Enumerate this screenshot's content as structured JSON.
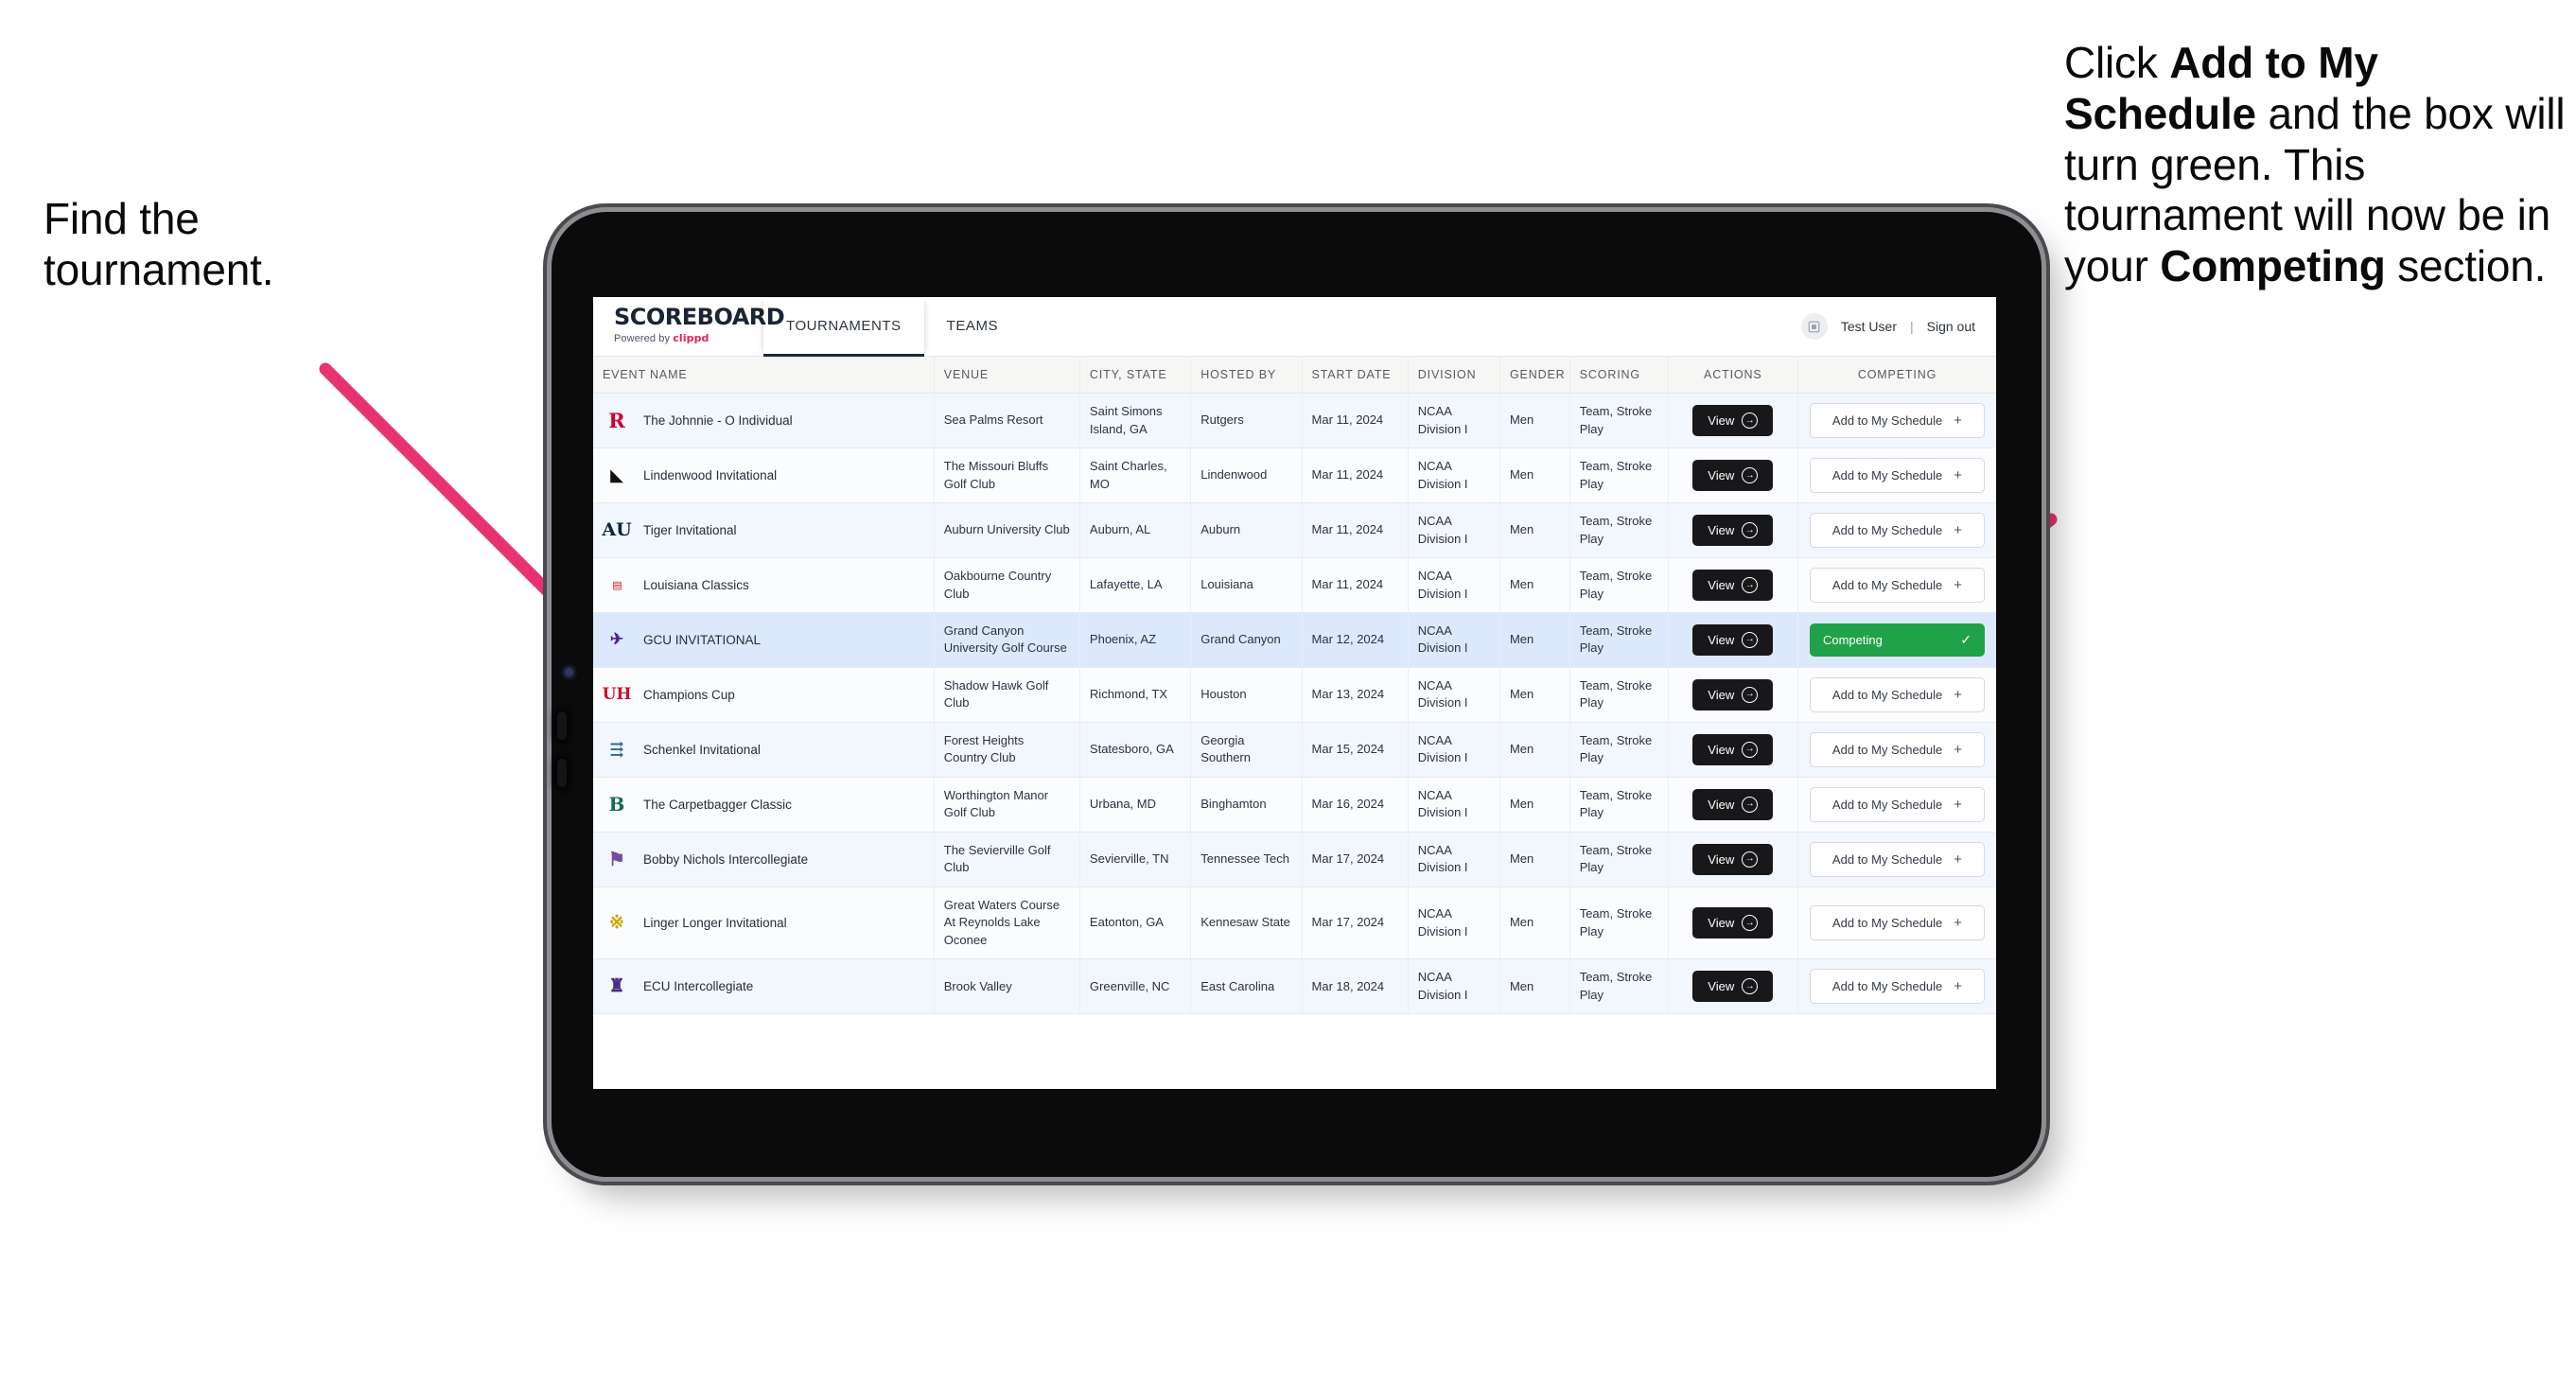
{
  "annotations": {
    "left": {
      "line1": "Find the",
      "line2": "tournament."
    },
    "right": {
      "seg1": "Click ",
      "bold1": "Add to My Schedule",
      "seg2": " and the box will turn green. This tournament will now be in your ",
      "bold2": "Competing",
      "seg3": " section."
    },
    "arrow_color": "#e8336d"
  },
  "app": {
    "brand": {
      "title": "SCOREBOARD",
      "powered_prefix": "Powered by ",
      "powered_name": "clippd"
    },
    "tabs": [
      {
        "label": "TOURNAMENTS",
        "active": true
      },
      {
        "label": "TEAMS",
        "active": false
      }
    ],
    "header_right": {
      "avatar_icon": "user-avatar-icon",
      "user": "Test User",
      "separator": "|",
      "sign_out": "Sign out"
    }
  },
  "table": {
    "columns": [
      "EVENT NAME",
      "VENUE",
      "CITY, STATE",
      "HOSTED BY",
      "START DATE",
      "DIVISION",
      "GENDER",
      "SCORING",
      "ACTIONS",
      "COMPETING"
    ],
    "buttons": {
      "view": "View",
      "add": "Add to My Schedule",
      "competing": "Competing",
      "plus_glyph": "+",
      "check_glyph": "✓",
      "view_arrow_glyph": "→"
    },
    "rows": [
      {
        "logo": "rutgers-logo",
        "logo_text": "R",
        "logo_class": "lg-rutgers",
        "event": "The Johnnie - O Individual",
        "venue": "Sea Palms Resort",
        "city": "Saint Simons Island, GA",
        "host": "Rutgers",
        "date": "Mar 11, 2024",
        "division": "NCAA Division I",
        "gender": "Men",
        "scoring": "Team, Stroke Play",
        "competing": false
      },
      {
        "logo": "lindenwood-logo",
        "logo_text": "◣",
        "logo_class": "lg-lindenwood",
        "event": "Lindenwood Invitational",
        "venue": "The Missouri Bluffs Golf Club",
        "city": "Saint Charles, MO",
        "host": "Lindenwood",
        "date": "Mar 11, 2024",
        "division": "NCAA Division I",
        "gender": "Men",
        "scoring": "Team, Stroke Play",
        "competing": false
      },
      {
        "logo": "auburn-logo",
        "logo_text": "AU",
        "logo_class": "lg-auburn",
        "event": "Tiger Invitational",
        "venue": "Auburn University Club",
        "city": "Auburn, AL",
        "host": "Auburn",
        "date": "Mar 11, 2024",
        "division": "NCAA Division I",
        "gender": "Men",
        "scoring": "Team, Stroke Play",
        "competing": false
      },
      {
        "logo": "louisiana-logo",
        "logo_text": "▤",
        "logo_class": "lg-louisiana",
        "event": "Louisiana Classics",
        "venue": "Oakbourne Country Club",
        "city": "Lafayette, LA",
        "host": "Louisiana",
        "date": "Mar 11, 2024",
        "division": "NCAA Division I",
        "gender": "Men",
        "scoring": "Team, Stroke Play",
        "competing": false
      },
      {
        "logo": "gcu-logo",
        "logo_text": "✈",
        "logo_class": "lg-gcu",
        "event": "GCU INVITATIONAL",
        "venue": "Grand Canyon University Golf Course",
        "city": "Phoenix, AZ",
        "host": "Grand Canyon",
        "date": "Mar 12, 2024",
        "division": "NCAA Division I",
        "gender": "Men",
        "scoring": "Team, Stroke Play",
        "competing": true,
        "selected": true
      },
      {
        "logo": "houston-logo",
        "logo_text": "UH",
        "logo_class": "lg-houston",
        "event": "Champions Cup",
        "venue": "Shadow Hawk Golf Club",
        "city": "Richmond, TX",
        "host": "Houston",
        "date": "Mar 13, 2024",
        "division": "NCAA Division I",
        "gender": "Men",
        "scoring": "Team, Stroke Play",
        "competing": false
      },
      {
        "logo": "georgia-southern-logo",
        "logo_text": "⇶",
        "logo_class": "lg-gasouthern",
        "event": "Schenkel Invitational",
        "venue": "Forest Heights Country Club",
        "city": "Statesboro, GA",
        "host": "Georgia Southern",
        "date": "Mar 15, 2024",
        "division": "NCAA Division I",
        "gender": "Men",
        "scoring": "Team, Stroke Play",
        "competing": false
      },
      {
        "logo": "binghamton-logo",
        "logo_text": "B",
        "logo_class": "lg-binghamton",
        "event": "The Carpetbagger Classic",
        "venue": "Worthington Manor Golf Club",
        "city": "Urbana, MD",
        "host": "Binghamton",
        "date": "Mar 16, 2024",
        "division": "NCAA Division I",
        "gender": "Men",
        "scoring": "Team, Stroke Play",
        "competing": false
      },
      {
        "logo": "tennessee-tech-logo",
        "logo_text": "⚑",
        "logo_class": "lg-tntech",
        "event": "Bobby Nichols Intercollegiate",
        "venue": "The Sevierville Golf Club",
        "city": "Sevierville, TN",
        "host": "Tennessee Tech",
        "date": "Mar 17, 2024",
        "division": "NCAA Division I",
        "gender": "Men",
        "scoring": "Team, Stroke Play",
        "competing": false
      },
      {
        "logo": "kennesaw-state-logo",
        "logo_text": "※",
        "logo_class": "lg-kennesaw",
        "event": "Linger Longer Invitational",
        "venue": "Great Waters Course At Reynolds Lake Oconee",
        "city": "Eatonton, GA",
        "host": "Kennesaw State",
        "date": "Mar 17, 2024",
        "division": "NCAA Division I",
        "gender": "Men",
        "scoring": "Team, Stroke Play",
        "competing": false
      },
      {
        "logo": "ecu-logo",
        "logo_text": "♜",
        "logo_class": "lg-ecu",
        "event": "ECU Intercollegiate",
        "venue": "Brook Valley",
        "city": "Greenville, NC",
        "host": "East Carolina",
        "date": "Mar 18, 2024",
        "division": "NCAA Division I",
        "gender": "Men",
        "scoring": "Team, Stroke Play",
        "competing": false,
        "clipped": true
      }
    ]
  }
}
